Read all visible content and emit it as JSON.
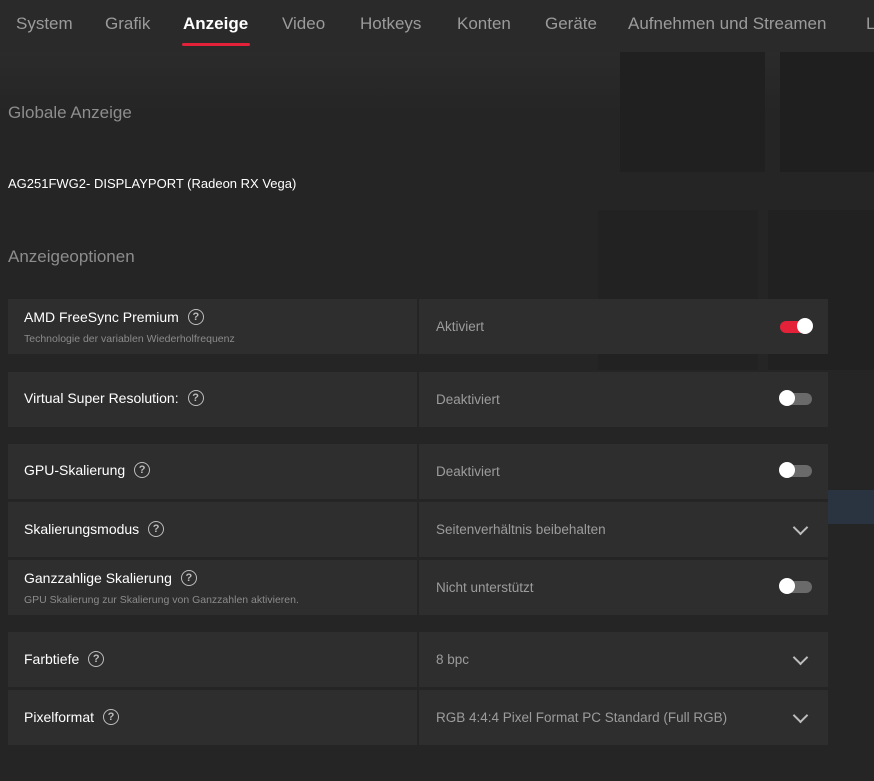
{
  "tabs": [
    {
      "label": "System"
    },
    {
      "label": "Grafik"
    },
    {
      "label": "Anzeige"
    },
    {
      "label": "Video"
    },
    {
      "label": "Hotkeys"
    },
    {
      "label": "Konten"
    },
    {
      "label": "Geräte"
    },
    {
      "label": "Aufnehmen und Streamen"
    },
    {
      "label": "L"
    }
  ],
  "active_tab": "Anzeige",
  "global_display": {
    "title": "Globale Anzeige",
    "display_name": "AG251FWG2- DISPLAYPORT (Radeon RX Vega)"
  },
  "options": {
    "title": "Anzeigeoptionen",
    "rows": [
      {
        "label": "AMD FreeSync Premium",
        "sub": "Technologie der variablen Wiederholfrequenz",
        "value": "Aktiviert",
        "control": "toggle",
        "on": true
      },
      {
        "label": "Virtual Super Resolution:",
        "value": "Deaktiviert",
        "control": "toggle",
        "on": false
      },
      {
        "label": "GPU-Skalierung",
        "value": "Deaktiviert",
        "control": "toggle",
        "on": false
      },
      {
        "label": "Skalierungsmodus",
        "value": "Seitenverhältnis beibehalten",
        "control": "dropdown"
      },
      {
        "label": "Ganzzahlige Skalierung",
        "sub": "GPU Skalierung zur Skalierung von Ganzzahlen aktivieren.",
        "value": "Nicht unterstützt",
        "control": "toggle",
        "on": false
      },
      {
        "label": "Farbtiefe",
        "value": "8 bpc",
        "control": "dropdown"
      },
      {
        "label": "Pixelformat",
        "value": "RGB 4:4:4 Pixel Format PC Standard (Full RGB)",
        "control": "dropdown"
      }
    ]
  },
  "help_glyph": "?",
  "colors": {
    "accent": "#e3223a",
    "background": "#252525",
    "row_bg": "#2e2e2e"
  }
}
